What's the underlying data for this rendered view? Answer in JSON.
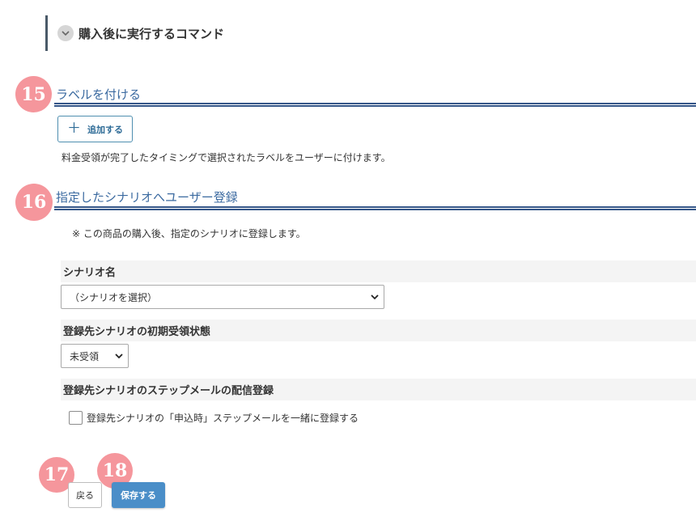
{
  "command_section": {
    "title": "購入後に実行するコマンド",
    "icon": "chevron-down-icon"
  },
  "label_section": {
    "badge": "15",
    "title": "ラベルを付ける",
    "add_button_label": "追加する",
    "add_icon": "plus-icon",
    "description": "料金受領が完了したタイミングで選択されたラベルをユーザーに付けます。"
  },
  "scenario_section": {
    "badge": "16",
    "title": "指定したシナリオへユーザー登録",
    "note": "※ この商品の購入後、指定のシナリオに登録します。",
    "scenario_name_label": "シナリオ名",
    "scenario_select_value": "（シナリオを選択）",
    "initial_status_label": "登録先シナリオの初期受領状態",
    "initial_status_value": "未受領",
    "step_mail_label": "登録先シナリオのステップメールの配信登録",
    "step_mail_checkbox_label": "登録先シナリオの「申込時」ステップメールを一緒に登録する"
  },
  "footer": {
    "badge_back": "17",
    "badge_save": "18",
    "back_label": "戻る",
    "save_label": "保存する"
  },
  "colors": {
    "badge": "#f5969c",
    "section_title": "#3b6aa0",
    "rule": "#355689",
    "primary_button": "#4a8ec8"
  }
}
